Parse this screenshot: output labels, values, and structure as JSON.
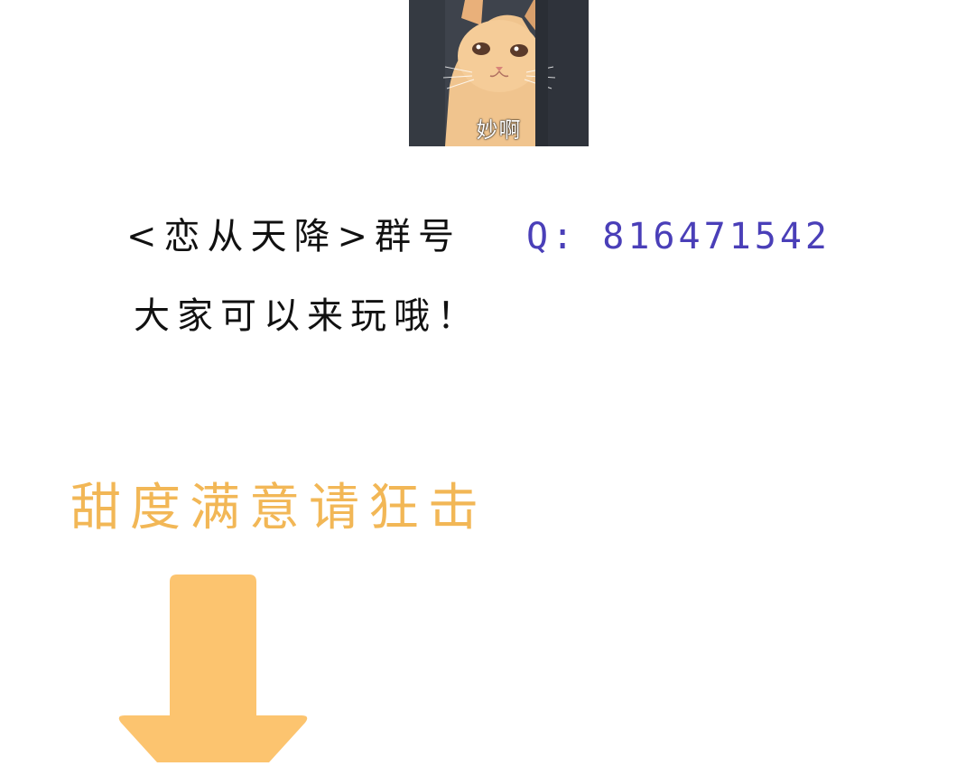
{
  "meme": {
    "caption": "妙啊",
    "icon": "cat-meme-image"
  },
  "group": {
    "label": "<恋从天降>群号",
    "qq": "Q: 816471542"
  },
  "invite": {
    "text": "大家可以来玩哦！"
  },
  "sweetness": {
    "text": "甜度满意请狂击"
  },
  "arrow": {
    "icon": "down-arrow-icon",
    "color": "#fcc46f"
  },
  "colors": {
    "qq_text": "#4a3fb8",
    "sweet_text": "#f2b756",
    "body_text": "#111111"
  }
}
